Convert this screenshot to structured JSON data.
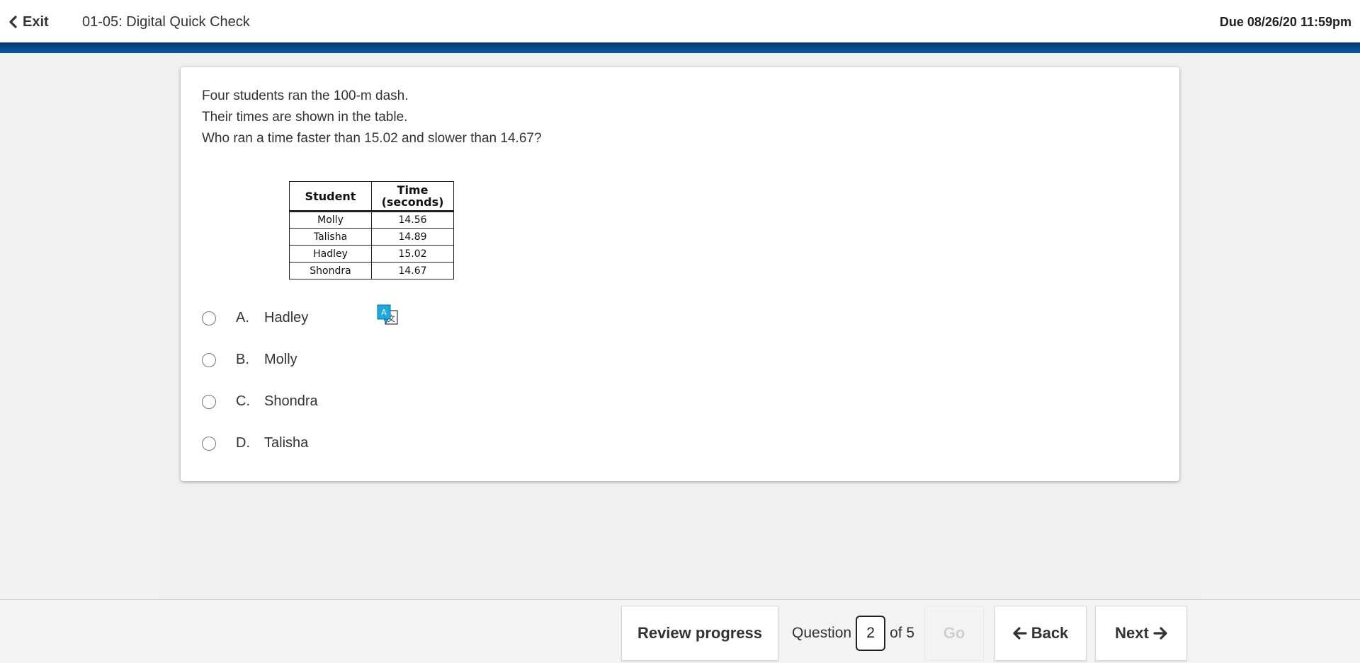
{
  "header": {
    "exit_label": "Exit",
    "assignment_title": "01-05: Digital Quick Check",
    "due": "Due 08/26/20 11:59pm",
    "accent_color": "#0b5aa6"
  },
  "question": {
    "prompt_lines": [
      "Four students ran the 100-m dash.",
      "Their times are shown in the table.",
      "Who ran a time faster than 15.02 and slower than 14.67?"
    ],
    "table": {
      "headers": [
        "Student",
        "Time (seconds)"
      ],
      "header_time_line1": "Time",
      "header_time_line2": "(seconds)",
      "rows": [
        [
          "Molly",
          "14.56"
        ],
        [
          "Talisha",
          "14.89"
        ],
        [
          "Hadley",
          "15.02"
        ],
        [
          "Shondra",
          "14.67"
        ]
      ]
    },
    "choices": [
      {
        "letter": "A.",
        "text": "Hadley"
      },
      {
        "letter": "B.",
        "text": "Molly"
      },
      {
        "letter": "C.",
        "text": "Shondra"
      },
      {
        "letter": "D.",
        "text": "Talisha"
      }
    ],
    "translate_icon": "translate-icon"
  },
  "footer": {
    "review_label": "Review progress",
    "question_label": "Question",
    "current_question": "2",
    "of_label": "of 5",
    "go_label": "Go",
    "back_label": "Back",
    "next_label": "Next"
  }
}
